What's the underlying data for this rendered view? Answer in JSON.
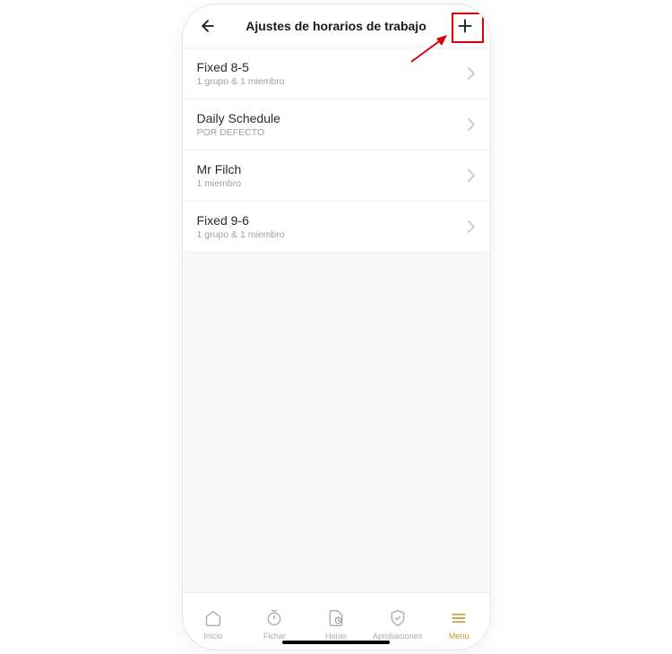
{
  "header": {
    "title": "Ajustes de horarios de trabajo"
  },
  "schedules": [
    {
      "title": "Fixed 8-5",
      "subtitle": "1 grupo & 1 miembro"
    },
    {
      "title": "Daily Schedule",
      "subtitle": "POR DEFECTO"
    },
    {
      "title": "Mr Filch",
      "subtitle": "1 miembro"
    },
    {
      "title": "Fixed 9-6",
      "subtitle": "1 grupo & 1 miembro"
    }
  ],
  "nav": {
    "items": [
      {
        "label": "Inicio",
        "icon": "home"
      },
      {
        "label": "Fichar",
        "icon": "timer"
      },
      {
        "label": "Horas",
        "icon": "hours"
      },
      {
        "label": "Aprobaciones",
        "icon": "shield"
      },
      {
        "label": "Menú",
        "icon": "menu",
        "active": true
      }
    ]
  }
}
